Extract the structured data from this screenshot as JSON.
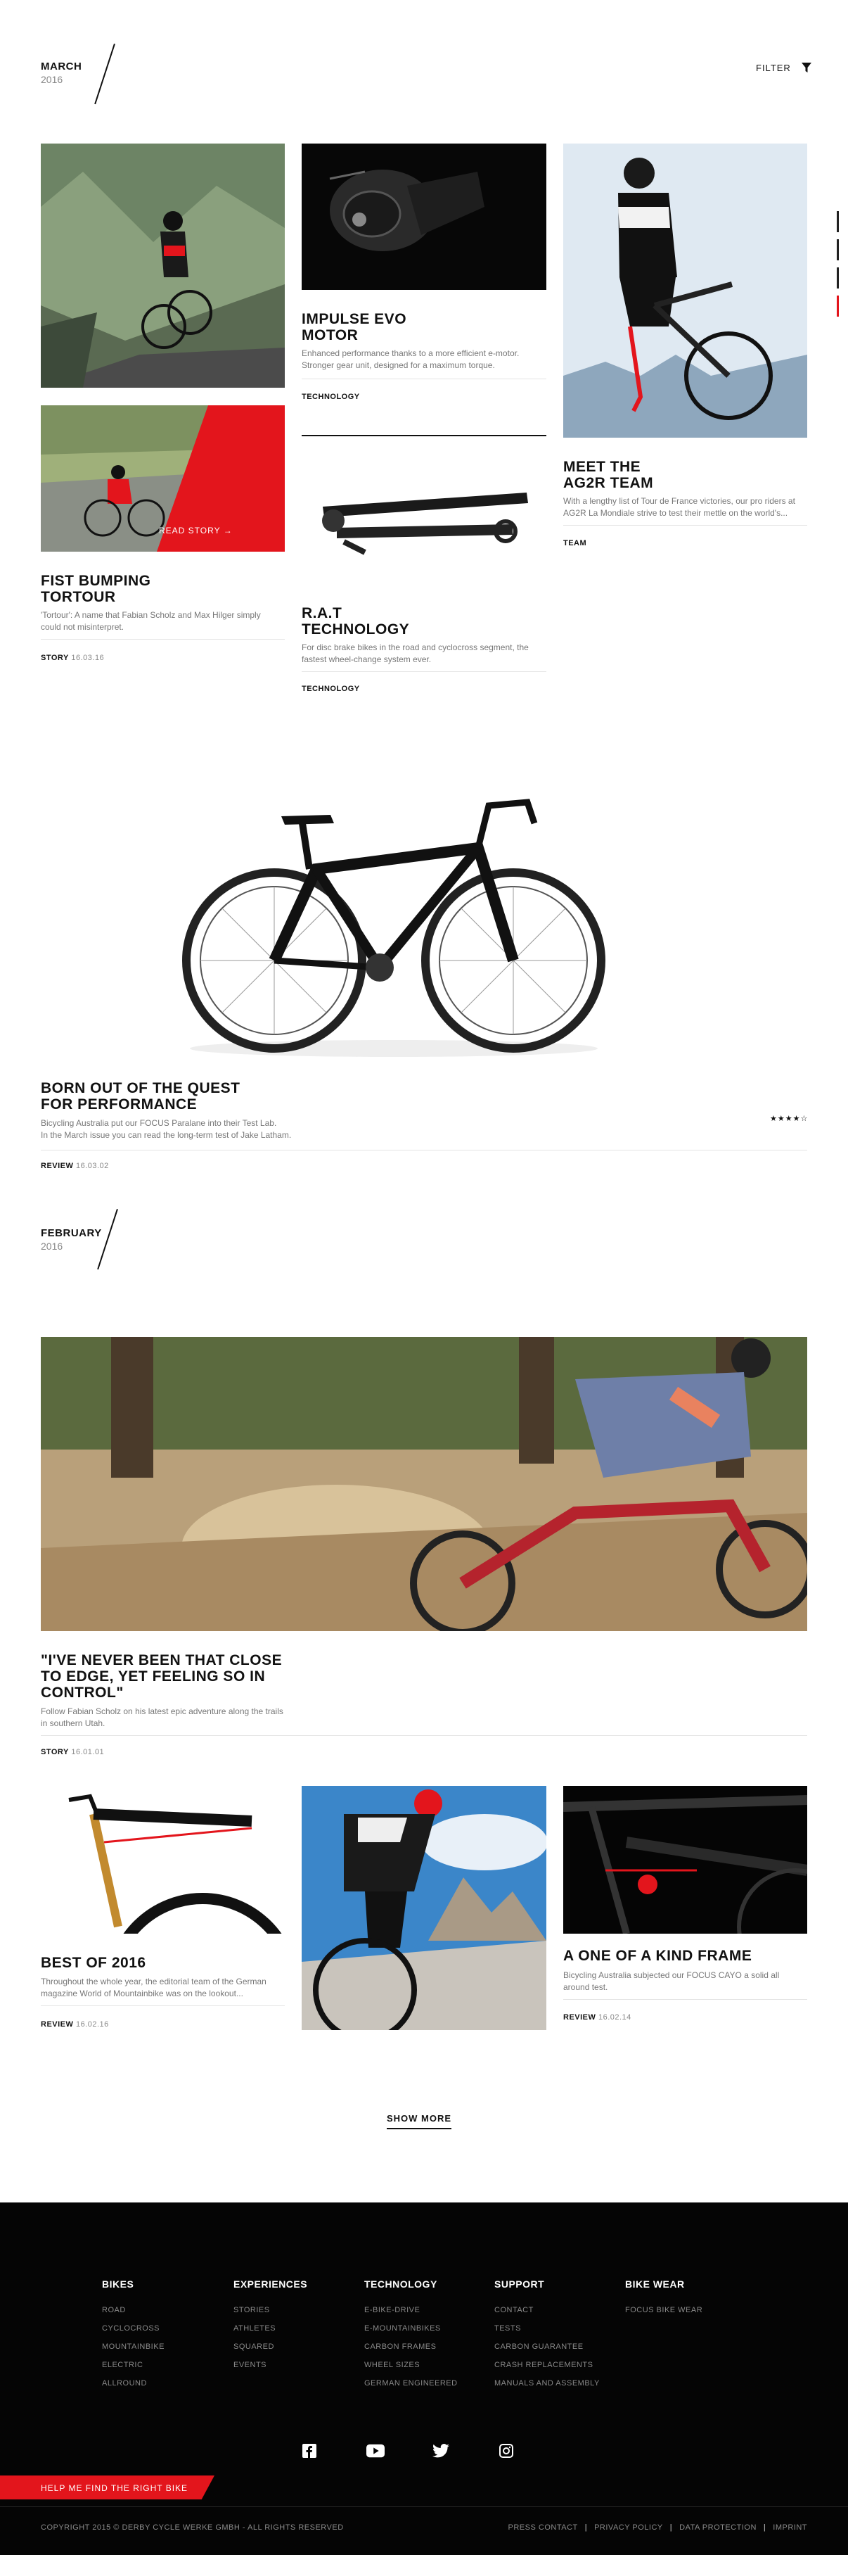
{
  "colors": {
    "accent": "#e3151c",
    "footer_bg": "#050505",
    "text": "#111111",
    "muted": "#777777"
  },
  "march": {
    "month": "MARCH",
    "year": "2016"
  },
  "filter": {
    "label": "FILTER",
    "icon": "filter-icon"
  },
  "cards": [
    {
      "title": "FIST BUMPING\nTORTOUR",
      "desc": "'Tortour': A name that Fabian Scholz and Max Hilger simply could not misinterpret.",
      "category": "STORY",
      "date": "16.03.16"
    },
    {
      "title": "IMPULSE EVO\nMOTOR",
      "desc": "Enhanced performance thanks to a more efficient e-motor. Stronger gear unit, designed for a maximum torque.",
      "category": "TECHNOLOGY",
      "date": ""
    },
    {
      "title": "R.A.T\nTECHNOLOGY",
      "desc": "For disc brake bikes in the road and cyclocross segment, the fastest wheel-change system ever.",
      "category": "TECHNOLOGY",
      "date": ""
    },
    {
      "title": "MEET THE\nAG2R TEAM",
      "desc": "With a lengthy list of Tour de France victories, our pro riders at AG2R La Mondiale strive to test their mettle on the world's...",
      "category": "TEAM",
      "date": ""
    }
  ],
  "read_story": "READ STORY →",
  "feature": {
    "title": "BORN OUT OF THE QUEST\nFOR PERFORMANCE",
    "desc_line1": "Bicycling Australia put our FOCUS Paralane into their Test Lab.",
    "desc_line2": "In the March issue you can read the long-term test of Jake Latham.",
    "category": "REVIEW",
    "date": "16.03.02",
    "rating": 4,
    "rating_text": "★★★★☆"
  },
  "february": {
    "month": "FEBRUARY",
    "year": "2016"
  },
  "story": {
    "title": "\"I'VE NEVER BEEN THAT CLOSE\nTO EDGE, YET FEELING SO IN\nCONTROL\"",
    "desc": "Follow Fabian Scholz on his latest epic adventure along the trails in southern Utah.",
    "category": "STORY",
    "date": "16.01.01"
  },
  "best": {
    "title": "BEST OF 2016",
    "desc": "Throughout the whole year, the editorial team of the German magazine World of Mountainbike was on the lookout...",
    "category": "REVIEW",
    "date": "16.02.16"
  },
  "frame": {
    "title": "A ONE OF A KIND FRAME",
    "desc": "Bicycling Australia subjected our FOCUS CAYO a solid all around test.",
    "category": "REVIEW",
    "date": "16.02.14"
  },
  "show_more": "SHOW MORE",
  "footer": {
    "columns": [
      {
        "heading": "BIKES",
        "links": [
          "ROAD",
          "CYCLOCROSS",
          "MOUNTAINBIKE",
          "ELECTRIC",
          "ALLROUND"
        ]
      },
      {
        "heading": "EXPERIENCES",
        "links": [
          "STORIES",
          "ATHLETES",
          "SQUARED",
          "EVENTS"
        ]
      },
      {
        "heading": "TECHNOLOGY",
        "links": [
          "E-BIKE-DRIVE",
          "E-MOUNTAINBIKES",
          "CARBON FRAMES",
          "WHEEL SIZES",
          "GERMAN ENGINEERED"
        ]
      },
      {
        "heading": "SUPPORT",
        "links": [
          "CONTACT",
          "TESTS",
          "CARBON GUARANTEE",
          "CRASH REPLACEMENTS",
          "MANUALS AND ASSEMBLY"
        ]
      },
      {
        "heading": "BIKE WEAR",
        "links": [
          "FOCUS BIKE WEAR"
        ]
      }
    ],
    "social": [
      "facebook-icon",
      "youtube-icon",
      "twitter-icon",
      "instagram-icon"
    ],
    "help_button": "HELP ME FIND THE RIGHT BIKE",
    "copyright": "COPYRIGHT 2015 © DERBY CYCLE WERKE GMBH - ALL RIGHTS RESERVED",
    "legal": [
      "PRESS CONTACT",
      "PRIVACY POLICY",
      "DATA PROTECTION",
      "IMPRINT"
    ]
  }
}
